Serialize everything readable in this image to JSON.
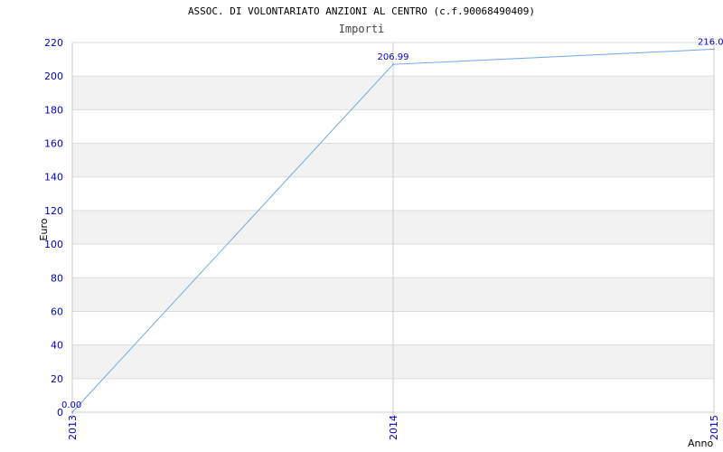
{
  "chart_data": {
    "type": "line",
    "title": "ASSOC. DI VOLONTARIATO ANZIONI AL CENTRO (c.f.90068490409)",
    "subtitle": "Importi",
    "xlabel": "Anno",
    "ylabel": "Euro",
    "categories": [
      "2013",
      "2014",
      "2015"
    ],
    "series": [
      {
        "values": [
          0.0,
          206.99,
          216.0
        ],
        "labels": [
          "0.00",
          "206.99",
          "216.0"
        ]
      }
    ],
    "ylim": [
      0,
      220
    ],
    "yticks": [
      0,
      20,
      40,
      60,
      80,
      100,
      120,
      140,
      160,
      180,
      200,
      220
    ],
    "grid": true,
    "legend": "none",
    "colors": {
      "line": "#6fa8e8",
      "label": "#0000cc",
      "band": "#f2f2f2",
      "gridline": "#dddddd",
      "axis": "#cccccc"
    }
  }
}
